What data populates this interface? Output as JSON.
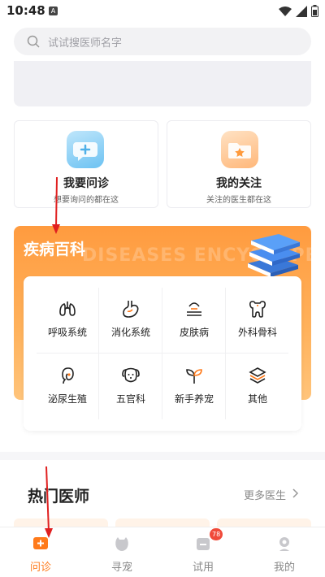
{
  "status_bar": {
    "time": "10:48",
    "sim_label": "A"
  },
  "search": {
    "placeholder": "试试搜医师名字"
  },
  "cards": [
    {
      "title": "我要问诊",
      "subtitle": "想要询问的都在这",
      "icon": "chat-plus-icon"
    },
    {
      "title": "我的关注",
      "subtitle": "关注的医生都在这",
      "icon": "folder-star-icon"
    }
  ],
  "encyclopedia": {
    "title": "疾病百科",
    "watermark": "DISEASES ENCYCLOPE",
    "categories": [
      {
        "label": "呼吸系统",
        "icon": "lungs-icon"
      },
      {
        "label": "消化系统",
        "icon": "stomach-icon"
      },
      {
        "label": "皮肤病",
        "icon": "skin-icon"
      },
      {
        "label": "外科骨科",
        "icon": "bone-icon"
      },
      {
        "label": "泌尿生殖",
        "icon": "kidney-icon"
      },
      {
        "label": "五官科",
        "icon": "dog-face-icon"
      },
      {
        "label": "新手养宠",
        "icon": "sprout-icon"
      },
      {
        "label": "其他",
        "icon": "layers-icon"
      }
    ]
  },
  "hot_doctors": {
    "title": "热门医师",
    "more": "更多医生"
  },
  "tabs": [
    {
      "label": "问诊",
      "icon": "consult-icon"
    },
    {
      "label": "寻宠",
      "icon": "pet-icon"
    },
    {
      "label": "试用",
      "icon": "trial-icon"
    },
    {
      "label": "我的",
      "icon": "profile-icon"
    }
  ],
  "badge": "78",
  "colors": {
    "accent": "#ff7a1a",
    "encyclopedia_bg": "#ff9b3f",
    "badge": "#f04a3a"
  }
}
